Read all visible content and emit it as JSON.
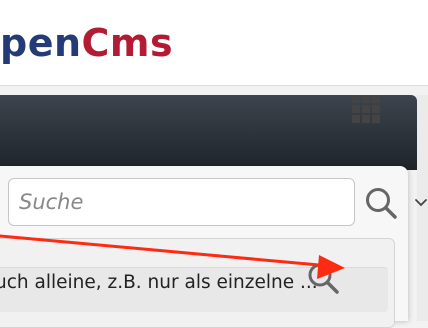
{
  "logo": {
    "text_part_1": "pen",
    "text_part_2": "Cms",
    "color_part_1": "#243b78",
    "color_part_2": "#b31b34"
  },
  "search": {
    "placeholder": "Suche",
    "button_icon": "search-icon"
  },
  "results": [
    {
      "text": "uch alleine, z.B. nur als einzelne ...",
      "action_icon": "magnifier-preview-icon"
    }
  ],
  "toolbar": {
    "options_icon": "grid-menu-icon"
  },
  "annotation": {
    "type": "arrow",
    "color": "#ff2a12"
  },
  "side": {
    "icon": "chevron-down-icon"
  }
}
